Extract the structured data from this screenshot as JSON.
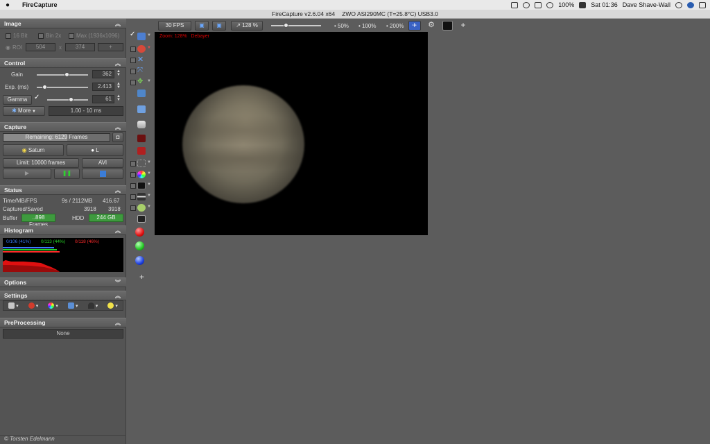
{
  "menubar": {
    "apple": "",
    "app_name": "FireCapture",
    "battery": "100%",
    "clock": "Sat 01:36",
    "user": "Dave Shave-Wall"
  },
  "window": {
    "title": "FireCapture v2.6.04  x64",
    "camera": "ZWO ASI290MC (T=25.8°C) USB3.0"
  },
  "image_section": {
    "title": "Image",
    "bit16": "16 Bit",
    "bin2x": "Bin 2x",
    "max_res": "Max (1936x1096)",
    "roi": "ROI",
    "roi_w": "504",
    "roi_x": "x",
    "roi_h": "374",
    "roi_select": "+"
  },
  "control_section": {
    "title": "Control",
    "gain_label": "Gain",
    "gain_value": "362",
    "gain_level": 0.6,
    "exp_label": "Exp. (ms)",
    "exp_value": "2.413",
    "exp_level": 0.12,
    "gamma_label": "Gamma",
    "gamma_value": "61",
    "gamma_level": 0.6,
    "more_label": "More",
    "exp_range": "1.00 - 10 ms"
  },
  "capture_section": {
    "title": "Capture",
    "remaining": "Remaining:  6129 Frames",
    "profile": "Saturn",
    "filter": "L",
    "limit": "Limit: 10000 frames",
    "format": "AVI"
  },
  "status_section": {
    "title": "Status",
    "time_label": "Time/MB/FPS",
    "time_value": "9s / 2112MB",
    "fps_value": "416.67",
    "captured_label": "Captured/Saved",
    "captured_value": "3918",
    "saved_value": "3918",
    "buffer_label": "Buffer",
    "buffer_value": "..898 Frames",
    "hdd_label": "HDD",
    "hdd_value": "244 GB"
  },
  "histogram_section": {
    "title": "Histogram",
    "blue": "0/106 (41%)",
    "green": "0/113 (44%)",
    "red": "0/118 (46%)"
  },
  "options_section": {
    "title": "Options"
  },
  "settings_section": {
    "title": "Settings"
  },
  "preprocessing_section": {
    "title": "PreProcessing",
    "value": "None"
  },
  "copyright": "© Torsten Edelmann",
  "toolbar": {
    "fps": "30 FPS",
    "zoom": "128 %",
    "zoom_level": 0.28,
    "z50": "50%",
    "z100": "100%",
    "z200": "200%",
    "add": "+"
  },
  "preview": {
    "zoom_text": "Zoom: 128%",
    "debayer_text": "Debayer"
  },
  "icon_column": {
    "add": "+"
  },
  "colors": {
    "histo_blue": "#3a7bff",
    "histo_green": "#27d627",
    "histo_red": "#ff2a2a",
    "hdd_green": "#3e9a3e"
  }
}
